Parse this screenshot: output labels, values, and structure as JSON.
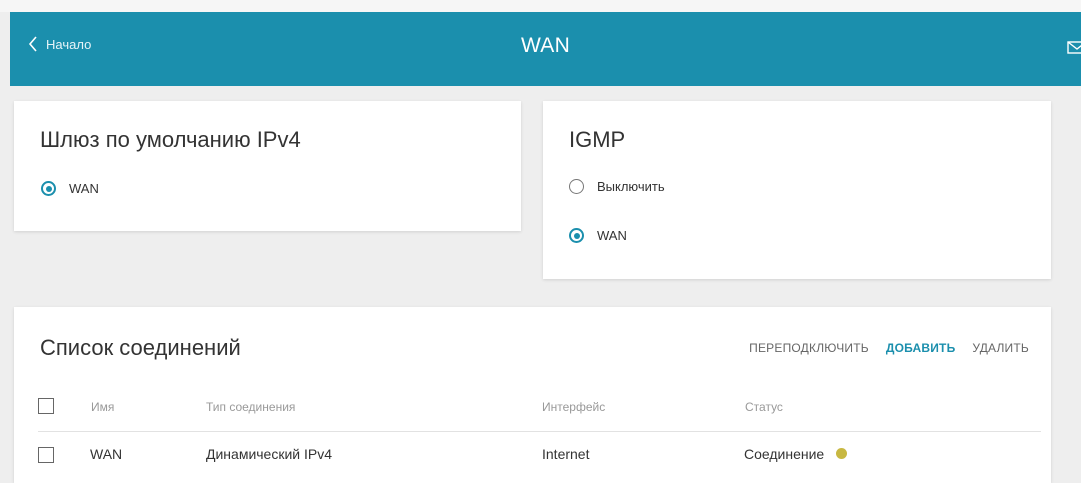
{
  "header": {
    "back_label": "Начало",
    "title": "WAN",
    "bg_color": "#1b8fad"
  },
  "gateway": {
    "title": "Шлюз по умолчанию IPv4",
    "options": [
      {
        "label": "WAN",
        "selected": true
      }
    ]
  },
  "igmp": {
    "title": "IGMP",
    "options": [
      {
        "label": "Выключить",
        "selected": false
      },
      {
        "label": "WAN",
        "selected": true
      }
    ]
  },
  "connections": {
    "title": "Список соединений",
    "actions": {
      "reconnect": "ПЕРЕПОДКЛЮЧИТЬ",
      "add": "ДОБАВИТЬ",
      "delete": "УДАЛИТЬ"
    },
    "columns": [
      "Имя",
      "Тип соединения",
      "Интерфейс",
      "Статус"
    ],
    "rows": [
      {
        "name": "WAN",
        "type": "Динамический IPv4",
        "interface": "Internet",
        "status": "Соединение",
        "status_color": "#c8b842"
      }
    ]
  },
  "icons": [
    "chevron-left-icon",
    "mail-icon",
    "radio-icon",
    "checkbox-icon",
    "status-dot-icon"
  ]
}
